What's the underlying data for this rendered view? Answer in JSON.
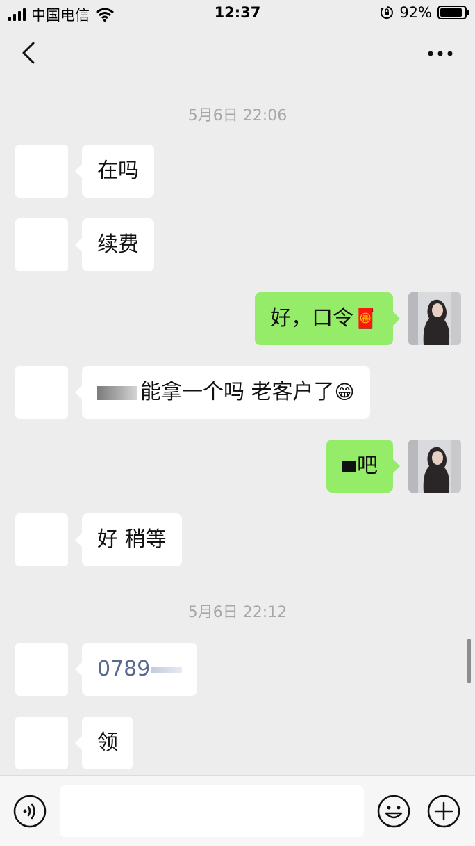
{
  "status_bar": {
    "carrier": "中国电信",
    "time": "12:37",
    "battery_percent": "92%",
    "battery_level": 0.92
  },
  "nav": {
    "back_icon": "chevron-left-icon",
    "more_icon": "more-horizontal-icon"
  },
  "timestamps": [
    "5月6日 22:06",
    "5月6日 22:12"
  ],
  "messages": [
    {
      "side": "in",
      "text": "在吗"
    },
    {
      "side": "in",
      "text": "续费"
    },
    {
      "side": "out",
      "text": "好，口令",
      "emoji": "🧧"
    },
    {
      "side": "in",
      "text": "能拿一个吗 老客户了",
      "emoji": "😁"
    },
    {
      "side": "out",
      "text": "吧"
    },
    {
      "side": "in",
      "text": "好 稍等"
    },
    {
      "side": "in",
      "text": "0789"
    },
    {
      "side": "in",
      "text": "领"
    }
  ],
  "input_bar": {
    "voice_icon": "voice-icon",
    "emoji_icon": "emoji-icon",
    "plus_icon": "plus-icon",
    "input_value": ""
  }
}
